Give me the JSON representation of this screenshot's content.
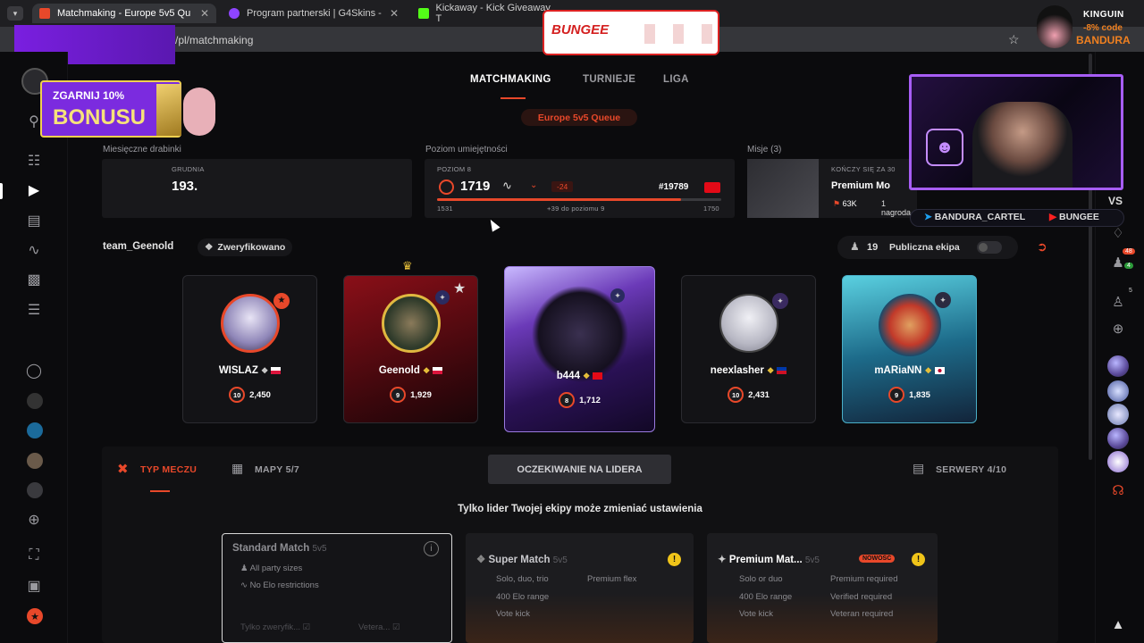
{
  "browser": {
    "tabs": [
      {
        "title": "Matchmaking - Europe 5v5 Qu",
        "active": true
      },
      {
        "title": "Program partnerski | G4Skins -",
        "active": false
      },
      {
        "title": "Kickaway - Kick Giveaway T",
        "active": false
      }
    ],
    "url": "/pl/matchmaking"
  },
  "nav": {
    "items": [
      "MATCHMAKING",
      "TURNIEJE",
      "LIGA"
    ],
    "active": "MATCHMAKING"
  },
  "queue": "Europe 5v5 Queue",
  "stats": {
    "monthly_label": "Miesięczne drabinki",
    "monthly_month": "GRUDNIA",
    "monthly_rank": "193.",
    "skill_label": "Poziom umiejętności",
    "skill_level": "POZIOM 8",
    "elo": "1719",
    "elo_change": "-24",
    "rank": "#19789",
    "range_min": "1531",
    "range_max": "1750",
    "to_next": "+39 do poziomu 9",
    "progress": 0.86,
    "missions_label": "Misje (3)",
    "mission_ends": "KOŃCZY SIĘ ZA 30",
    "mission_title": "Premium Mo",
    "mission_reward": "63K",
    "mission_prize": "1 nagroda"
  },
  "team": {
    "name": "team_Geenold",
    "verified": "Zweryfikowano",
    "count": "19",
    "public_label": "Publiczna ekipa",
    "players": [
      {
        "name": "WISLAZ",
        "level": "10",
        "elo": "2,450",
        "flag": "PL"
      },
      {
        "name": "Geenold",
        "level": "9",
        "elo": "1,929",
        "flag": "PL"
      },
      {
        "name": "b444",
        "level": "8",
        "elo": "1,712",
        "flag": "TR"
      },
      {
        "name": "neexlasher",
        "level": "10",
        "elo": "2,431",
        "flag": "PH"
      },
      {
        "name": "mARiaNN",
        "level": "9",
        "elo": "1,835",
        "flag": "JP"
      }
    ]
  },
  "settings": {
    "tab_match_type": "TYP MECZU",
    "tab_maps": "MAPY 5/7",
    "waiting": "OCZEKIWANIE NA LIDERA",
    "servers": "SERWERY 4/10",
    "leader_notice": "Tylko lider Twojej ekipy może zmieniać ustawienia"
  },
  "modes": [
    {
      "title": "Standard Match",
      "format": "5v5",
      "lines": [
        "All party sizes",
        "No Elo restrictions"
      ],
      "chips": [
        "Tylko zweryfik...",
        "Vetera..."
      ]
    },
    {
      "title": "Super Match",
      "format": "5v5",
      "lines": [
        "Solo, duo, trio",
        "400 Elo range",
        "Vote kick"
      ],
      "right": [
        "Premium flex"
      ]
    },
    {
      "title": "Premium Mat...",
      "format": "5v5",
      "badge": "NOWOŚĆ",
      "lines": [
        "Solo or duo",
        "400 Elo range",
        "Vote kick"
      ],
      "right": [
        "Premium required",
        "Verified required",
        "Veteran required"
      ]
    }
  ],
  "overlay": {
    "bungee": "BUNGEE",
    "bonus_top": "ZGARNIJ 10%",
    "bonus_main": "BONUSU",
    "kinguin": "KINGUIN",
    "kinguin_code": "-8% code",
    "kinguin_name": "BANDURA",
    "social_1": "BANDURA_CARTEL",
    "social_2": "BUNGEE",
    "vs": "VS"
  },
  "right_badges": {
    "friends": "48",
    "online": "4",
    "party": "5"
  },
  "colors": {
    "accent": "#e8482a",
    "bg": "#0b0b0d",
    "panel": "#18181b"
  }
}
